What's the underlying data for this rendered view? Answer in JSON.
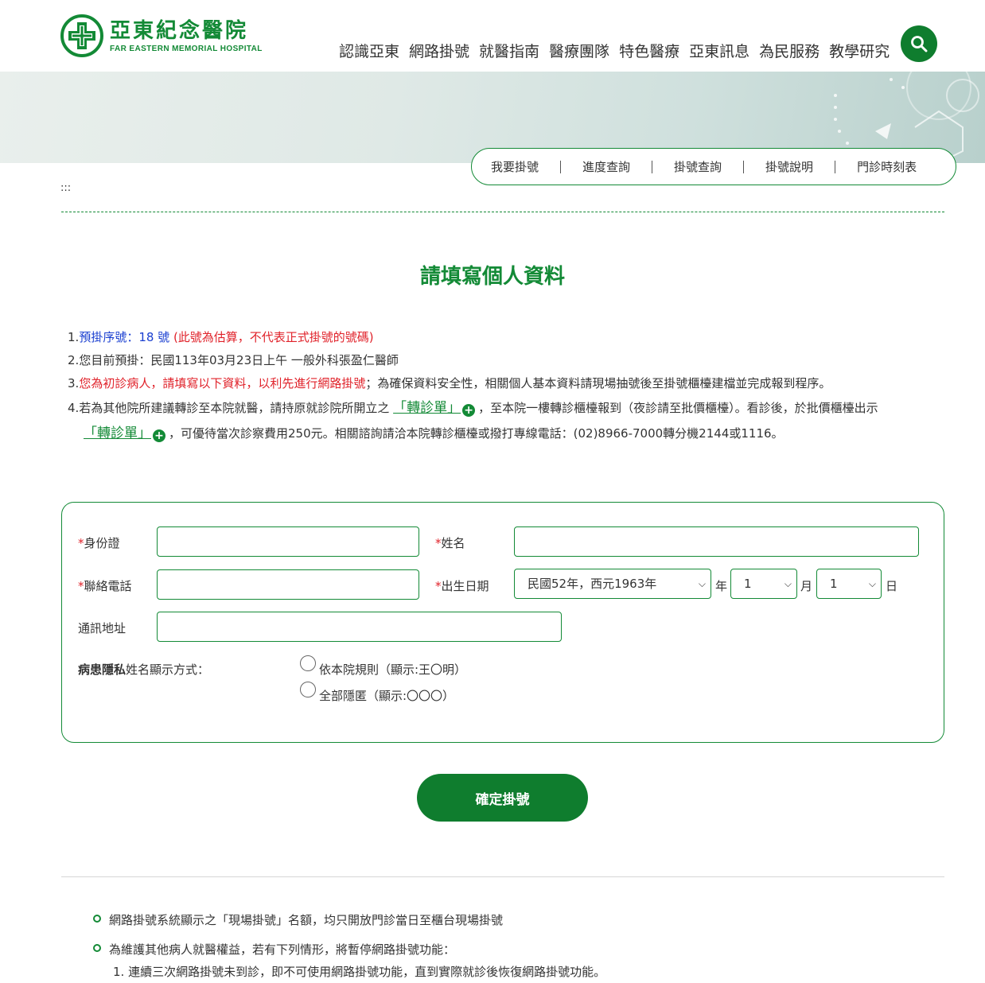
{
  "header": {
    "logo_zh": "亞東紀念醫院",
    "logo_en": "FAR EASTERN MEMORIAL HOSPITAL",
    "nav": [
      "認識亞東",
      "網路掛號",
      "就醫指南",
      "醫療團隊",
      "特色醫療",
      "亞東訊息",
      "為民服務",
      "教學研究"
    ],
    "brand_color": "#138a36",
    "search_icon": "search-icon"
  },
  "sub_nav": [
    "我要掛號",
    "進度查詢",
    "掛號查詢",
    "掛號說明",
    "門診時刻表"
  ],
  "breadcrumb": ":::",
  "page_title": "請填寫個人資料",
  "notes": {
    "n1": "1.",
    "n1_label": "預掛序號：18 號",
    "n1_red": "(此號為估算，不代表正式掛號的號碼)",
    "n2": "2.",
    "n2_text": "您目前預掛：民國113年03月23日上午 一般外科張盈仁醫師",
    "n3": "3.",
    "n3_red": "您為初診病人，請填寫以下資料，以利先進行網路掛號",
    "n3_text": "；為確保資料安全性，相關個人基本資料請現場抽號後至掛號櫃檯建檔並完成報到程序。",
    "n4": "4.",
    "n4_a": "若為其他院所建議轉診至本院就醫，請持原就診院所開立之",
    "n4_link": "「轉診單」",
    "n4_b": "，至本院一樓轉診櫃檯報到（夜診請至批價櫃檯）。看診後，於批價櫃檯出示",
    "n4_link2": "「轉診單」",
    "n4_c": "，可優待當次診察費用250元。相關諮詢請洽本院轉診櫃檯或撥打專線電話：(02)8966-7000轉分機2144或1116。"
  },
  "form": {
    "id_label": "身份證",
    "name_label": "姓名",
    "phone_label": "聯絡電話",
    "birth_label": "出生日期",
    "address_label": "通訊地址",
    "required_mark": "*",
    "year_value": "民國52年，西元1963年",
    "year_unit": "年",
    "month_value": "1",
    "month_unit": "月",
    "day_value": "1",
    "day_unit": "日",
    "privacy_label_bold": "病患隱私",
    "privacy_label_rest": "姓名顯示方式：",
    "privacy_option1": "依本院規則（顯示:王〇明）",
    "privacy_option2": "全部隱匿（顯示:〇〇〇）"
  },
  "submit_label": "確定掛號",
  "footer_notes": {
    "b1": "網路掛號系統顯示之「現場掛號」名額，均只開放門診當日至櫃台現場掛號",
    "b2": "為維護其他病人就醫權益，若有下列情形，將暫停網路掛號功能：",
    "b2_1": "1. 連續三次網路掛號未到診，即不可使用網路掛號功能，直到實際就診後恢復網路掛號功能。"
  }
}
